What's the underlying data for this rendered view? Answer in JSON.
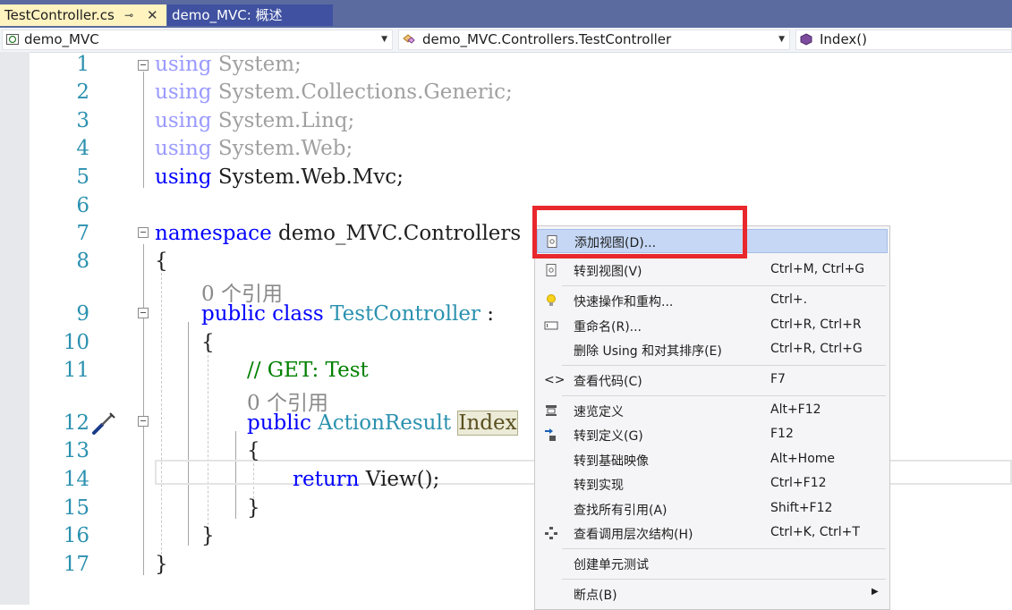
{
  "tabs": [
    {
      "label": "TestController.cs",
      "pin": "⊸",
      "close": "✕"
    },
    {
      "label": "demo_MVC: 概述"
    }
  ],
  "navbar": {
    "project": "demo_MVC",
    "class": "demo_MVC.Controllers.TestController",
    "member": "Index()"
  },
  "line_numbers": [
    "1",
    "2",
    "3",
    "4",
    "5",
    "6",
    "7",
    "8",
    "9",
    "10",
    "11",
    "12",
    "13",
    "14",
    "15",
    "16",
    "17"
  ],
  "code": {
    "using1_kw": "using",
    "using1_rest": " System;",
    "using2_kw": "using",
    "using2_rest": " System.Collections.Generic;",
    "using3_kw": "using",
    "using3_rest": " System.Linq;",
    "using4_kw": "using",
    "using4_rest": " System.Web;",
    "using5_kw": "using",
    "using5_rest": " System.Web.Mvc;",
    "ns_kw": "namespace",
    "ns_name": " demo_MVC.Controllers",
    "brace_open": "{",
    "brace_close": "}",
    "ref_class": "0 个引用",
    "class_kw1": "public",
    "class_kw2": "class",
    "class_name": "TestController",
    "class_tail": " :",
    "comment": "// GET: Test",
    "ref_method": "0 个引用",
    "method_kw": "public",
    "method_type": "ActionResult",
    "method_name": "Index",
    "return_kw": "return",
    "return_call": " View();"
  },
  "context_menu": {
    "items": [
      {
        "label": "添加视图(D)...",
        "shortcut": "",
        "icon": "add-view-icon",
        "selected": true
      },
      {
        "label": "转到视图(V)",
        "shortcut": "Ctrl+M, Ctrl+G",
        "icon": "go-to-view-icon"
      },
      {
        "label": "快速操作和重构...",
        "shortcut": "Ctrl+.",
        "icon": "lightbulb-icon"
      },
      {
        "label": "重命名(R)...",
        "shortcut": "Ctrl+R, Ctrl+R",
        "icon": "rename-icon"
      },
      {
        "label": "删除 Using 和对其排序(E)",
        "shortcut": "Ctrl+R, Ctrl+G",
        "icon": ""
      },
      {
        "label": "查看代码(C)",
        "shortcut": "F7",
        "icon": "view-code-icon"
      },
      {
        "label": "速览定义",
        "shortcut": "Alt+F12",
        "icon": "peek-definition-icon"
      },
      {
        "label": "转到定义(G)",
        "shortcut": "F12",
        "icon": "go-to-definition-icon"
      },
      {
        "label": "转到基础映像",
        "shortcut": "Alt+Home",
        "icon": ""
      },
      {
        "label": "转到实现",
        "shortcut": "Ctrl+F12",
        "icon": ""
      },
      {
        "label": "查找所有引用(A)",
        "shortcut": "Shift+F12",
        "icon": ""
      },
      {
        "label": "查看调用层次结构(H)",
        "shortcut": "Ctrl+K, Ctrl+T",
        "icon": "call-hierarchy-icon"
      },
      {
        "label": "创建单元测试",
        "shortcut": "",
        "icon": ""
      },
      {
        "label": "断点(B)",
        "shortcut": "",
        "icon": "",
        "submenu": "▶"
      }
    ]
  },
  "colors": {
    "tab_active_bg": "#fff3c0",
    "highlight_border": "#e8282c",
    "keyword": "#0000ff",
    "type": "#2b91af",
    "comment": "#008000"
  }
}
